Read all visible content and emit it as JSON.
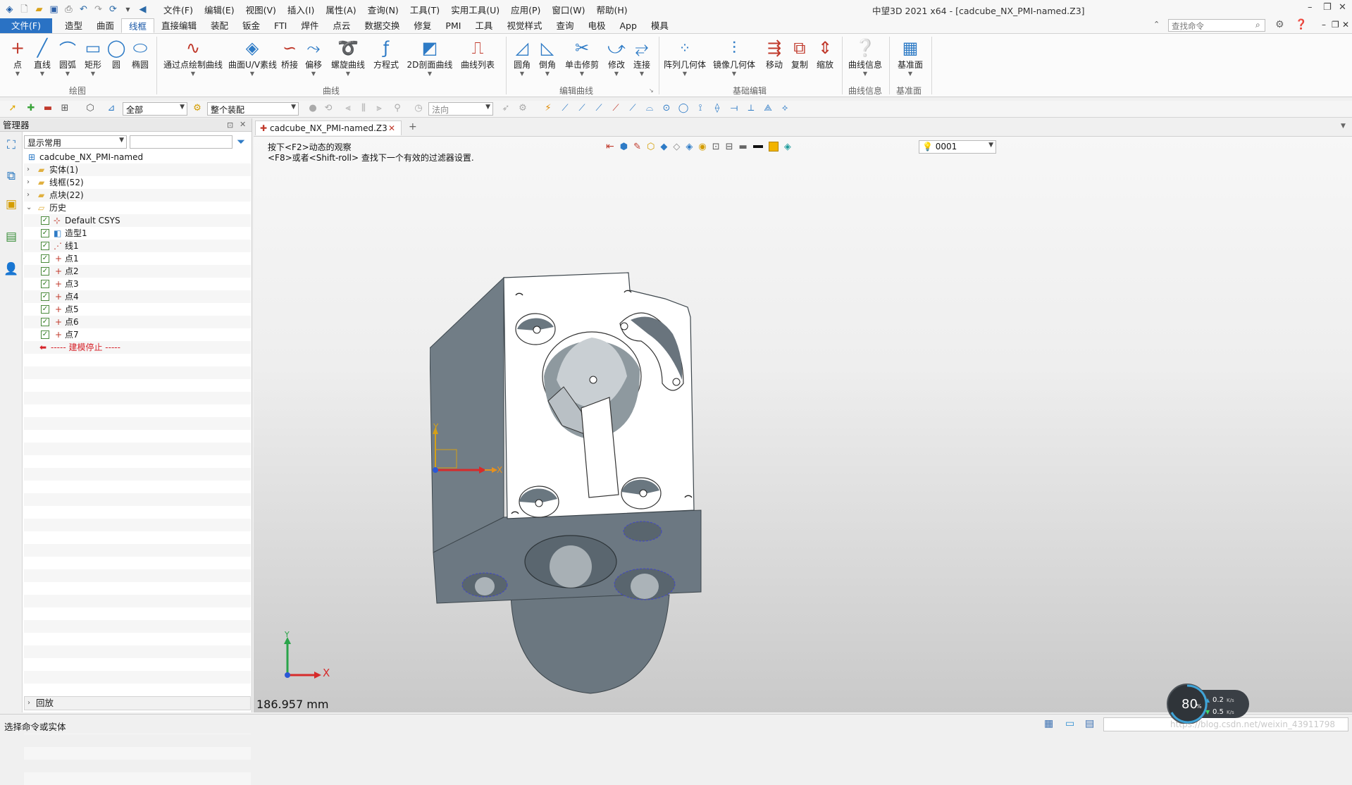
{
  "window": {
    "title": "中望3D 2021 x64 - [cadcube_NX_PMI-named.Z3]",
    "menu": [
      "文件(F)",
      "编辑(E)",
      "视图(V)",
      "插入(I)",
      "属性(A)",
      "查询(N)",
      "工具(T)",
      "实用工具(U)",
      "应用(P)",
      "窗口(W)",
      "帮助(H)"
    ]
  },
  "ribbon_tabs": [
    "文件(F)",
    "造型",
    "曲面",
    "线框",
    "直接编辑",
    "装配",
    "钣金",
    "FTI",
    "焊件",
    "点云",
    "数据交换",
    "修复",
    "PMI",
    "工具",
    "视觉样式",
    "查询",
    "电极",
    "App",
    "模具"
  ],
  "active_tab": "线框",
  "search": {
    "placeholder": "查找命令"
  },
  "ribbon_groups": {
    "draw": {
      "label": "绘图",
      "buttons": [
        "点",
        "直线",
        "圆弧",
        "矩形",
        "圆",
        "椭圆"
      ]
    },
    "curve": {
      "label": "曲线",
      "buttons": [
        "通过点绘制曲线",
        "曲面U/V素线",
        "桥接",
        "偏移",
        "螺旋曲线",
        "方程式",
        "2D剖面曲线",
        "曲线列表"
      ]
    },
    "edit_curve": {
      "label": "编辑曲线",
      "buttons": [
        "圆角",
        "倒角",
        "单击修剪",
        "修改",
        "连接"
      ]
    },
    "basic_edit": {
      "label": "基础编辑",
      "buttons": [
        "阵列几何体",
        "镜像几何体",
        "移动",
        "复制",
        "缩放"
      ]
    },
    "curve_info": {
      "label": "曲线信息",
      "buttons": [
        "曲线信息"
      ]
    },
    "datum": {
      "label": "基准面",
      "buttons": [
        "基准面"
      ]
    }
  },
  "toolbar2": {
    "filter": "全部",
    "assembly": "整个装配",
    "direction": "法向",
    "layer": "0001"
  },
  "manager": {
    "title": "管理器",
    "display_filter": "显示常用",
    "root": "cadcube_NX_PMI-named",
    "folders": [
      {
        "label": "实体(1)"
      },
      {
        "label": "线框(52)"
      },
      {
        "label": "点块(22)"
      },
      {
        "label": "历史"
      }
    ],
    "history": [
      "Default CSYS",
      "造型1",
      "线1",
      "点1",
      "点2",
      "点3",
      "点4",
      "点5",
      "点6",
      "点7"
    ],
    "stop_marker": "----- 建模停止 -----",
    "playback": "回放"
  },
  "document_tab": "cadcube_NX_PMI-named.Z3",
  "viewport": {
    "hint_line1": "按下<F2>动态的观察",
    "hint_line2": "<F8>或者<Shift-roll> 查找下一个有效的过滤器设置.",
    "scale": "186.957 mm",
    "triad_x": "X",
    "triad_y": "Y"
  },
  "status": {
    "text": "选择命令或实体"
  },
  "net_meter": {
    "percent": "80",
    "percent_unit": "%",
    "up": "0.2",
    "down": "0.5",
    "rate_unit": "K/s"
  },
  "watermark": "https://blog.csdn.net/weixin_43911798",
  "colors": {
    "accent": "#2a72c4",
    "model": "#6f7d86",
    "model_face": "#ffffff"
  }
}
